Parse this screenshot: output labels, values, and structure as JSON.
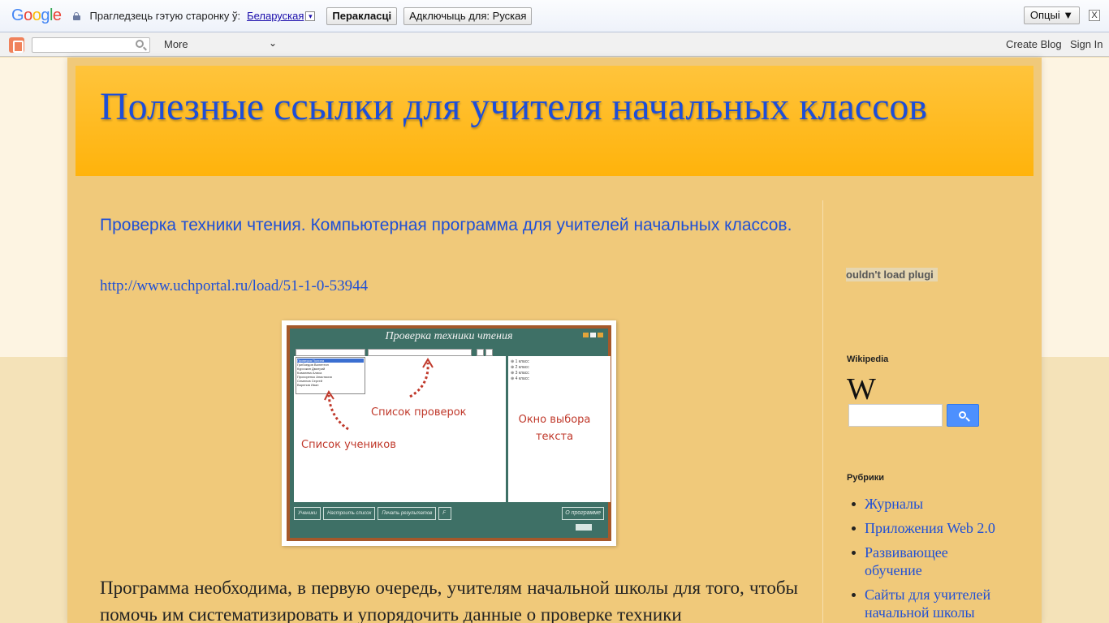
{
  "translate_bar": {
    "logo_letters": [
      "G",
      "o",
      "o",
      "g",
      "l",
      "e"
    ],
    "prompt": "Прагледзець гэтую старонку ў:",
    "language": "Беларуская",
    "translate_button": "Перакласці",
    "disable_button": "Адключыць для: Руская",
    "options_button": "Опцыі ▼",
    "close_glyph": "X"
  },
  "navbar": {
    "more": "More",
    "more_chevron": "⌄",
    "create_blog": "Create Blog",
    "sign_in": "Sign In"
  },
  "blog": {
    "title": "Полезные ссылки для учителя начальных классов"
  },
  "post": {
    "title": "Проверка техники чтения. Компьютерная программа для учителей начальных классов.",
    "link": "http://www.uchportal.ru/load/51-1-0-53944",
    "image": {
      "app_title": "Проверка техники чтения",
      "list_items": [
        "Проверка Полина",
        "Грибоедов Валентин",
        "Курочкин Дмитрий",
        "Ковалева Алиса",
        "Прохоренко Анастасия",
        "Семенов Сергей",
        "Варенов Иван"
      ],
      "tree_items": [
        "⊕ 1 класс",
        "⊕ 2 класс",
        "⊕ 3 класс",
        "⊕ 4 класс"
      ],
      "label_checks": "Список проверок",
      "label_students": "Список учеников",
      "label_text_window": "Окно выбора текста",
      "bottom_buttons": [
        "Ученики",
        "Настроить список",
        "Печать результатов"
      ],
      "about_button": "О программе"
    },
    "body": "Программа необходима, в первую очередь, учителям начальной школы для того, чтобы помочь им систематизировать и упорядочить данные о проверке техники"
  },
  "sidebar": {
    "plugin_text": "ouldn't load plugi",
    "wikipedia_title": "Wikipedia",
    "wikipedia_logo": "W",
    "rubrics_title": "Рубрики",
    "rubrics": [
      "Журналы",
      "Приложения Web 2.0",
      "Развивающее обучение",
      "Сайты для учителей начальной школы"
    ]
  }
}
